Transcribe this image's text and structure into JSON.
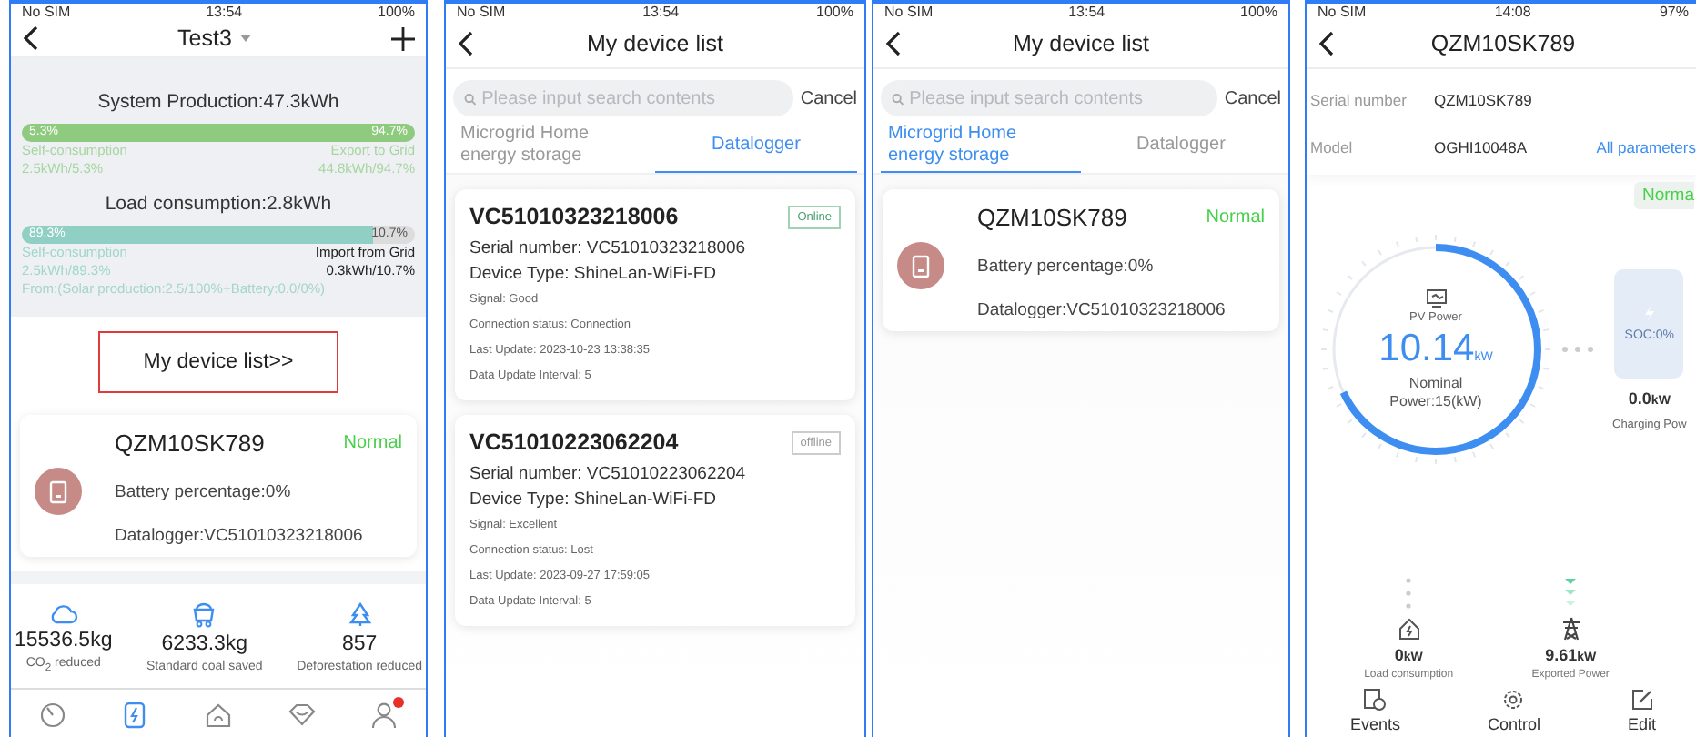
{
  "home_screen": {
    "status_bar": {
      "carrier": "No SIM",
      "time": "13:54",
      "battery": "100%"
    },
    "title": "Test3",
    "production": {
      "title": "System Production:47.3kWh",
      "level": 0.053,
      "left_pct": "5.3%",
      "right_pct": "94.7%",
      "left_label": "Self-consumption",
      "right_label": "Export to Grid",
      "left_value": "2.5kWh/5.3%",
      "right_value": "44.8kWh/94.7%"
    },
    "consumption": {
      "title": "Load consumption:2.8kWh",
      "level": 0.893,
      "left_pct": "89.3%",
      "right_pct": "10.7%",
      "left_label": "Self-consumption",
      "right_label": "Import from Grid",
      "left_value": "2.5kWh/89.3%",
      "right_value": "0.3kWh/10.7%",
      "source": "From:(Solar production:2.5/100%+Battery:0.0/0%)"
    },
    "device_list_link": "My device list>>",
    "device": {
      "name": "QZM10SK789",
      "status": "Normal",
      "battery": "Battery percentage:0%",
      "datalogger": "Datalogger:VC51010323218006"
    },
    "stats": [
      {
        "kind": "co2",
        "value": "15536.5kg",
        "label": "CO$_{2}$ reduced"
      },
      {
        "kind": "coal",
        "value": "6233.3kg",
        "label": "Standard coal saved"
      },
      {
        "kind": "tree",
        "value": "857",
        "label": "Deforestation reduced"
      }
    ],
    "tab_bar": [
      {
        "kind": "dashboard",
        "selected": false,
        "badge": false
      },
      {
        "kind": "plant",
        "selected": true,
        "badge": false
      },
      {
        "kind": "home",
        "selected": false,
        "badge": false
      },
      {
        "kind": "service",
        "selected": false,
        "badge": false
      },
      {
        "kind": "user",
        "selected": false,
        "badge": true
      }
    ]
  },
  "datalogger_screen": {
    "status_bar": {
      "carrier": "No SIM",
      "time": "13:54",
      "battery": "100%"
    },
    "title": "My device list",
    "search": {
      "placeholder": "Please input search contents"
    },
    "cancel": "Cancel",
    "tabs": [
      {
        "label": "Microgrid Home energy storage",
        "selected": false
      },
      {
        "label": "Datalogger",
        "selected": true
      }
    ],
    "dataloggers": [
      {
        "name": "VC51010323218006",
        "status": "Online",
        "online": true,
        "serial": "Serial number: VC51010323218006",
        "type": "Device Type: ShineLan-WiFi-FD",
        "signal": "Signal: Good",
        "connection": "Connection status: Connection",
        "last_update": "Last Update: 2023-10-23 13:38:35",
        "interval": "Data Update Interval: 5"
      },
      {
        "name": "VC51010223062204",
        "status": "offline",
        "online": false,
        "serial": "Serial number: VC51010223062204",
        "type": "Device Type: ShineLan-WiFi-FD",
        "signal": "Signal: Excellent",
        "connection": "Connection status: Lost",
        "last_update": "Last Update: 2023-09-27 17:59:05",
        "interval": "Data Update Interval: 5"
      }
    ]
  },
  "storage_screen": {
    "status_bar": {
      "carrier": "No SIM",
      "time": "13:54",
      "battery": "100%"
    },
    "title": "My device list",
    "search": {
      "placeholder": "Please input search contents"
    },
    "cancel": "Cancel",
    "tabs": [
      {
        "label": "Microgrid Home energy storage",
        "selected": true
      },
      {
        "label": "Datalogger",
        "selected": false
      }
    ],
    "device": {
      "name": "QZM10SK789",
      "status": "Normal",
      "battery": "Battery percentage:0%",
      "datalogger": "Datalogger:VC51010323218006"
    }
  },
  "detail_screen": {
    "status_bar": {
      "carrier": "No SIM",
      "time": "14:08",
      "battery": "97%"
    },
    "title": "QZM10SK789",
    "serial_label": "Serial number",
    "serial": "QZM10SK789",
    "model_label": "Model",
    "model": "OGHI10048A",
    "all_parameters": "All parameters",
    "status": "Norma",
    "pv": {
      "label": "PV Power",
      "value": "10.14",
      "unit": "kW",
      "nominal": "Nominal Power:15(kW)",
      "level": 0.68
    },
    "battery": {
      "soc": "SOC:0%",
      "value": "0.0",
      "unit": "kW",
      "label": "Charging Pow"
    },
    "load": {
      "value": "0",
      "unit": "kW",
      "label": "Load consumption"
    },
    "grid": {
      "value": "9.61",
      "unit": "kW",
      "label": "Exported Power"
    },
    "actions": [
      {
        "kind": "events",
        "label": "Events"
      },
      {
        "kind": "control",
        "label": "Control"
      },
      {
        "kind": "edit",
        "label": "Edit"
      }
    ]
  }
}
